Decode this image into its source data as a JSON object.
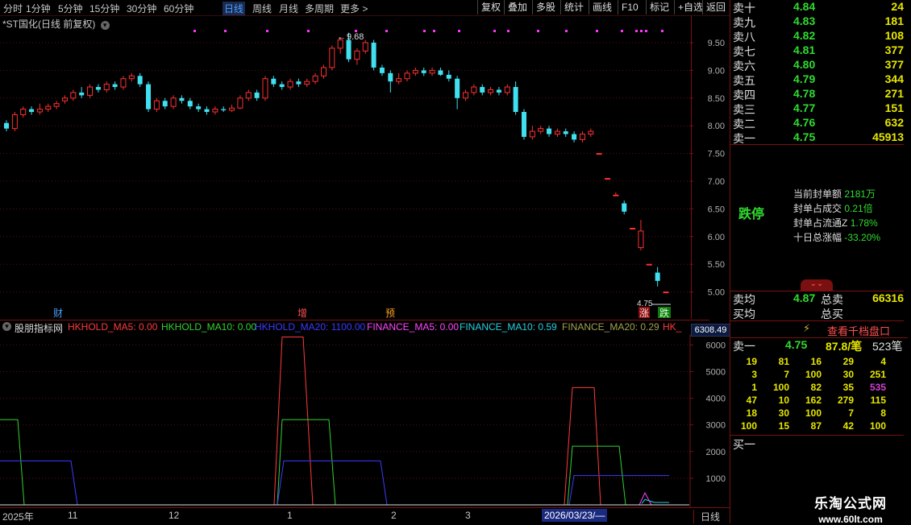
{
  "toolbar": {
    "periods": [
      "分时",
      "1分钟",
      "5分钟",
      "15分钟",
      "30分钟",
      "60分钟",
      "日线",
      "周线",
      "月线",
      "多周期",
      "更多 >"
    ],
    "buttons": [
      "复权",
      "叠加",
      "多股",
      "统计",
      "画线",
      "F10",
      "标记",
      "+自选",
      "返回"
    ]
  },
  "main_chart": {
    "title": "*ST国化(日线 前复权)",
    "y_axis": [
      "9.50",
      "9.00",
      "8.50",
      "8.00",
      "7.50",
      "7.00",
      "6.50",
      "6.00",
      "5.50",
      "5.00"
    ],
    "peak_label": "9.68",
    "low_label": "4.75",
    "event_markers": [
      "财",
      "增",
      "预",
      "涨",
      "跌"
    ]
  },
  "indicator": {
    "name": "股朋指标网",
    "legend": [
      {
        "text": "HKHOLD_MA5: 0.00",
        "color": "#ff3b3b"
      },
      {
        "text": "HKHOLD_MA10: 0.00",
        "color": "#31d231"
      },
      {
        "text": "HKHOLD_MA20: 1100.00",
        "color": "#3b3bff"
      },
      {
        "text": "FINANCE_MA5: 0.00",
        "color": "#ff44ff"
      },
      {
        "text": "FINANCE_MA10: 0.59",
        "color": "#22d0e0"
      },
      {
        "text": "FINANCE_MA20: 0.29",
        "color": "#a0a050"
      },
      {
        "text": "HK_",
        "color": "#ff3b3b"
      }
    ],
    "value_box": "6308.49",
    "y_axis": [
      "6000",
      "5000",
      "4000",
      "3000",
      "2000",
      "1000"
    ]
  },
  "x_axis": {
    "labels": [
      "2025年",
      "11",
      "12",
      "1",
      "2",
      "3"
    ],
    "cursor_date": "2026/03/23/—",
    "period": "日线"
  },
  "order_book": {
    "asks": [
      {
        "label": "卖十",
        "price": "4.84",
        "vol": "24"
      },
      {
        "label": "卖九",
        "price": "4.83",
        "vol": "181"
      },
      {
        "label": "卖八",
        "price": "4.82",
        "vol": "108"
      },
      {
        "label": "卖七",
        "price": "4.81",
        "vol": "377"
      },
      {
        "label": "卖六",
        "price": "4.80",
        "vol": "377"
      },
      {
        "label": "卖五",
        "price": "4.79",
        "vol": "344"
      },
      {
        "label": "卖四",
        "price": "4.78",
        "vol": "271"
      },
      {
        "label": "卖三",
        "price": "4.77",
        "vol": "151"
      },
      {
        "label": "卖二",
        "price": "4.76",
        "vol": "632"
      },
      {
        "label": "卖一",
        "price": "4.75",
        "vol": "45913"
      }
    ],
    "status": "跌停",
    "stats": [
      {
        "label": "当前封单额",
        "value": "2181万"
      },
      {
        "label": "封单占成交",
        "value": "0.21倍"
      },
      {
        "label": "封单占流通Z",
        "value": "1.78%"
      },
      {
        "label": "十日总涨幅",
        "value": "-33.20%"
      }
    ],
    "avg_sell": {
      "label": "卖均",
      "price": "4.87",
      "total_label": "总卖",
      "total": "66316"
    },
    "avg_buy": {
      "label": "买均",
      "total_label": "总买"
    },
    "qianda_button": "查看千档盘口",
    "sell_one": {
      "label": "卖一",
      "price": "4.75",
      "per": "87.8/笔",
      "count": "523笔"
    },
    "queue": [
      [
        "19",
        "81",
        "16",
        "29",
        "4"
      ],
      [
        "3",
        "7",
        "100",
        "30",
        "251"
      ],
      [
        "1",
        "100",
        "82",
        "35",
        "535"
      ],
      [
        "47",
        "10",
        "162",
        "279",
        "115"
      ],
      [
        "18",
        "30",
        "100",
        "7",
        "8"
      ],
      [
        "100",
        "15",
        "87",
        "42",
        "100"
      ]
    ],
    "buy_one": {
      "label": "买一"
    }
  },
  "watermark": {
    "title": "乐淘公式网",
    "url": "www.60lt.com"
  }
}
